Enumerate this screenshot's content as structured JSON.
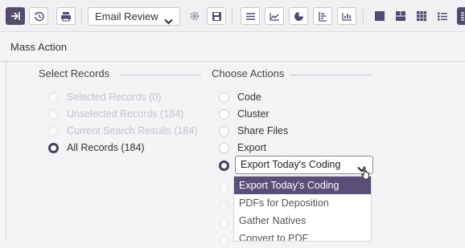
{
  "toolbar": {
    "view_select_value": "Email Review",
    "buttons": [
      {
        "name": "navigate-arrow-icon",
        "active": true
      },
      {
        "name": "history-icon"
      },
      {
        "name": "print-icon"
      },
      {
        "name": "gear-icon"
      },
      {
        "name": "save-icon"
      },
      {
        "name": "list-view-icon"
      },
      {
        "name": "line-chart-icon"
      },
      {
        "name": "pie-chart-icon"
      },
      {
        "name": "report-icon"
      },
      {
        "name": "bar-chart-icon"
      },
      {
        "name": "single-pane-icon"
      },
      {
        "name": "two-pane-icon"
      },
      {
        "name": "grid-pane-icon"
      },
      {
        "name": "bullet-list-icon"
      }
    ]
  },
  "panel": {
    "title": "Mass Action",
    "select_records": {
      "legend": "Select Records",
      "options": [
        {
          "label": "Selected Records (0)",
          "disabled": true,
          "checked": false
        },
        {
          "label": "Unselected Records (184)",
          "disabled": true,
          "checked": false
        },
        {
          "label": "Current Search Results (184)",
          "disabled": true,
          "checked": false
        },
        {
          "label": "All Records (184)",
          "disabled": false,
          "checked": true
        }
      ]
    },
    "choose_actions": {
      "legend": "Choose Actions",
      "options": [
        {
          "label": "Code"
        },
        {
          "label": "Cluster"
        },
        {
          "label": "Share Files"
        },
        {
          "label": "Export"
        }
      ],
      "export_select_value": "Export Today's Coding",
      "dropdown_items": [
        "Export Today's Coding",
        "PDFs for Deposition",
        "Gather Natives",
        "Convert to PDF"
      ]
    }
  },
  "colors": {
    "accent": "#5b4f78",
    "dark_accent": "#54496e"
  }
}
